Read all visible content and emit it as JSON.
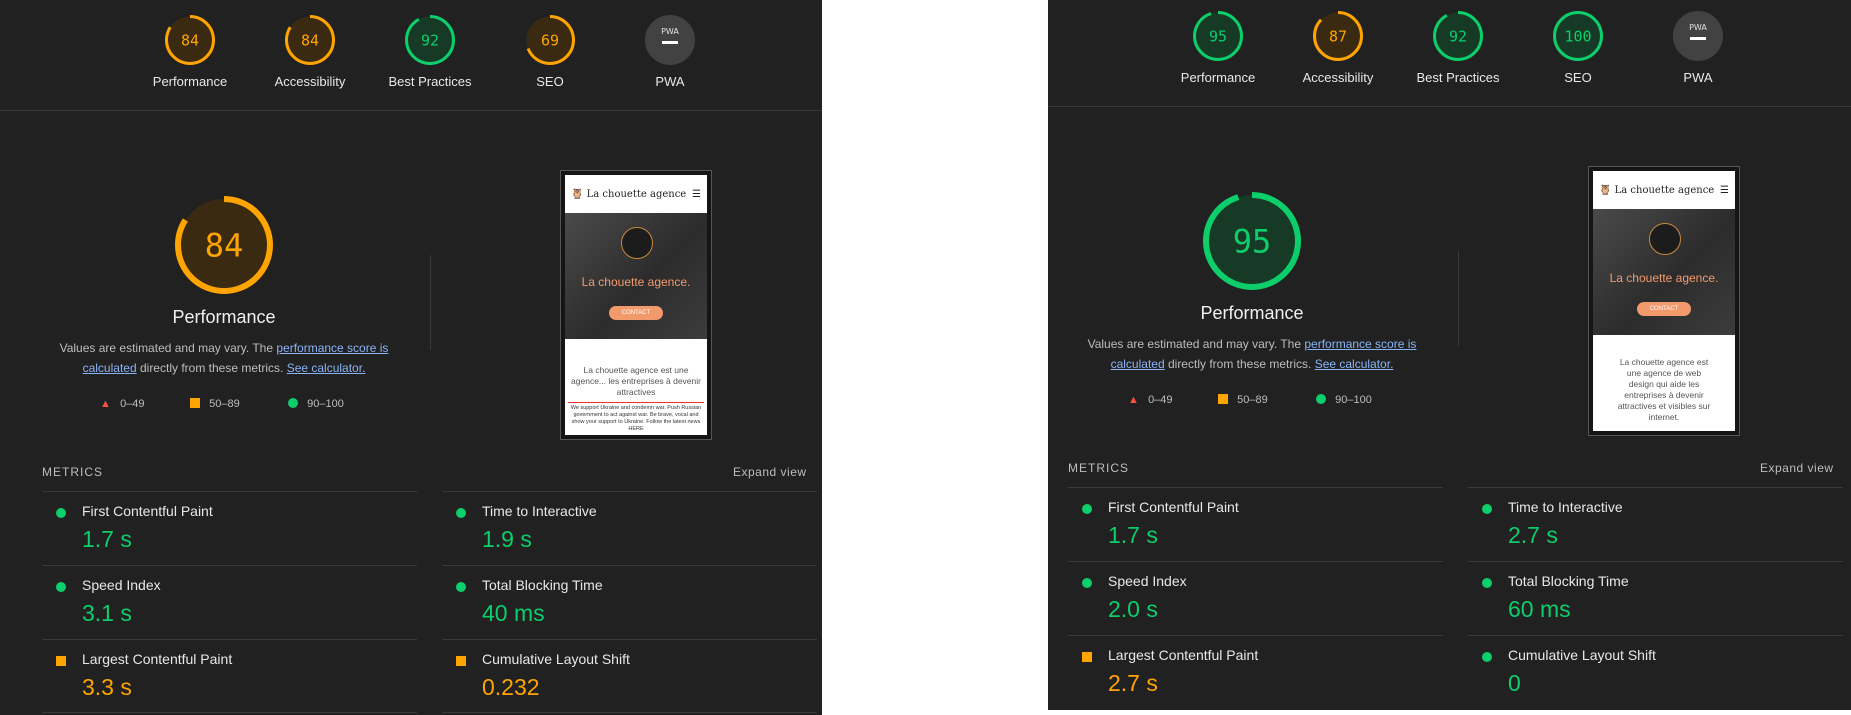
{
  "colors": {
    "pass": "#0cce6b",
    "average": "#ffa400",
    "fail": "#ff4e42",
    "na": "#9e9e9e",
    "link": "#8ab4f8"
  },
  "panels": [
    {
      "gauges": [
        {
          "score": "84",
          "label": "Performance",
          "status": "average",
          "fraction": 0.84
        },
        {
          "score": "84",
          "label": "Accessibility",
          "status": "average",
          "fraction": 0.84
        },
        {
          "score": "92",
          "label": "Best Practices",
          "status": "pass",
          "fraction": 0.92
        },
        {
          "score": "69",
          "label": "SEO",
          "status": "average",
          "fraction": 0.69
        },
        {
          "score": "",
          "label": "PWA",
          "status": "na",
          "fraction": 0,
          "badge": "PWA"
        }
      ],
      "main": {
        "score": "84",
        "status": "average",
        "fraction": 0.84,
        "title": "Performance"
      },
      "preview": {
        "brand": "La chouette agence",
        "hero_title": "La chouette agence.",
        "cta": "CONTACT",
        "body": "La chouette agence est une agence... les entreprises à devenir attractives",
        "footer": "We support Ukraine and condemn war. Push Russian government to act against war. Be brave, vocal and show your support to Ukraine. Follow the latest news HERE"
      },
      "metrics": [
        {
          "label": "First Contentful Paint",
          "value": "1.7 s",
          "status": "pass"
        },
        {
          "label": "Time to Interactive",
          "value": "1.9 s",
          "status": "pass"
        },
        {
          "label": "Speed Index",
          "value": "3.1 s",
          "status": "pass"
        },
        {
          "label": "Total Blocking Time",
          "value": "40 ms",
          "status": "pass"
        },
        {
          "label": "Largest Contentful Paint",
          "value": "3.3 s",
          "status": "average"
        },
        {
          "label": "Cumulative Layout Shift",
          "value": "0.232",
          "status": "average"
        }
      ]
    },
    {
      "gauges": [
        {
          "score": "95",
          "label": "Performance",
          "status": "pass",
          "fraction": 0.95
        },
        {
          "score": "87",
          "label": "Accessibility",
          "status": "average",
          "fraction": 0.87
        },
        {
          "score": "92",
          "label": "Best Practices",
          "status": "pass",
          "fraction": 0.92
        },
        {
          "score": "100",
          "label": "SEO",
          "status": "pass",
          "fraction": 1.0
        },
        {
          "score": "",
          "label": "PWA",
          "status": "na",
          "fraction": 0,
          "badge": "PWA"
        }
      ],
      "main": {
        "score": "95",
        "status": "pass",
        "fraction": 0.95,
        "title": "Performance"
      },
      "preview": {
        "brand": "La chouette agence",
        "hero_title": "La chouette agence.",
        "cta": "CONTACT",
        "body": "La chouette agence est une agence de web design qui aide les entreprises à devenir attractives et visibles sur internet.",
        "footer": ""
      },
      "metrics": [
        {
          "label": "First Contentful Paint",
          "value": "1.7 s",
          "status": "pass"
        },
        {
          "label": "Time to Interactive",
          "value": "2.7 s",
          "status": "pass"
        },
        {
          "label": "Speed Index",
          "value": "2.0 s",
          "status": "pass"
        },
        {
          "label": "Total Blocking Time",
          "value": "60 ms",
          "status": "pass"
        },
        {
          "label": "Largest Contentful Paint",
          "value": "2.7 s",
          "status": "average"
        },
        {
          "label": "Cumulative Layout Shift",
          "value": "0",
          "status": "pass"
        }
      ]
    }
  ],
  "text": {
    "desc_prefix": "Values are estimated and may vary. The ",
    "desc_link1": "performance score is calculated",
    "desc_middle": " directly from these metrics. ",
    "desc_link2": "See calculator.",
    "legend_fail": "0–49",
    "legend_average": "50–89",
    "legend_pass": "90–100",
    "metrics_heading": "METRICS",
    "expand_view": "Expand view"
  }
}
